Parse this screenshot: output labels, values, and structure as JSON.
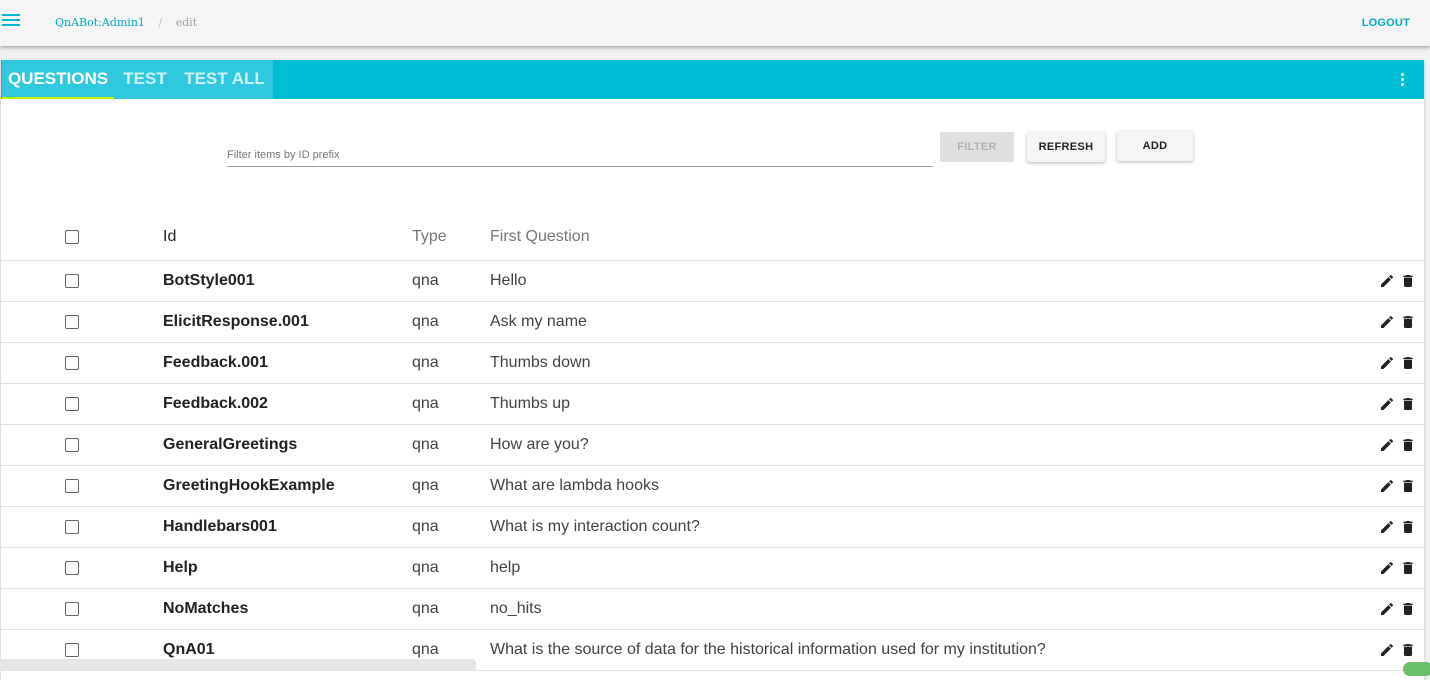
{
  "topbar": {
    "app_name": "QnABot:Admin1",
    "separator": "/",
    "page": "edit",
    "logout_label": "LOGOUT"
  },
  "tabs": [
    {
      "label": "QUESTIONS",
      "active": true
    },
    {
      "label": "TEST",
      "active": false
    },
    {
      "label": "TEST ALL",
      "active": false
    }
  ],
  "filter": {
    "placeholder": "Filter items by ID prefix",
    "value": "",
    "filter_label": "FILTER",
    "refresh_label": "REFRESH",
    "add_label": "ADD"
  },
  "table": {
    "headers": {
      "id": "Id",
      "type": "Type",
      "question": "First Question"
    },
    "rows": [
      {
        "id": "BotStyle001",
        "type": "qna",
        "question": "Hello"
      },
      {
        "id": "ElicitResponse.001",
        "type": "qna",
        "question": "Ask my name"
      },
      {
        "id": "Feedback.001",
        "type": "qna",
        "question": "Thumbs down"
      },
      {
        "id": "Feedback.002",
        "type": "qna",
        "question": "Thumbs up"
      },
      {
        "id": "GeneralGreetings",
        "type": "qna",
        "question": "How are you?"
      },
      {
        "id": "GreetingHookExample",
        "type": "qna",
        "question": "What are lambda hooks"
      },
      {
        "id": "Handlebars001",
        "type": "qna",
        "question": "What is my interaction count?"
      },
      {
        "id": "Help",
        "type": "qna",
        "question": "help"
      },
      {
        "id": "NoMatches",
        "type": "qna",
        "question": "no_hits"
      },
      {
        "id": "QnA01",
        "type": "qna",
        "question": "What is the source of data for the historical information used for my institution?"
      }
    ]
  },
  "icons": {
    "menu": "menu-icon",
    "more": "more-vert-icon",
    "edit": "pencil-icon",
    "delete": "trash-icon"
  },
  "colors": {
    "accent": "#00bcd4",
    "tab_bg": "#2fc8de",
    "tab_indicator": "#c6ff00",
    "link": "#00acc1"
  }
}
